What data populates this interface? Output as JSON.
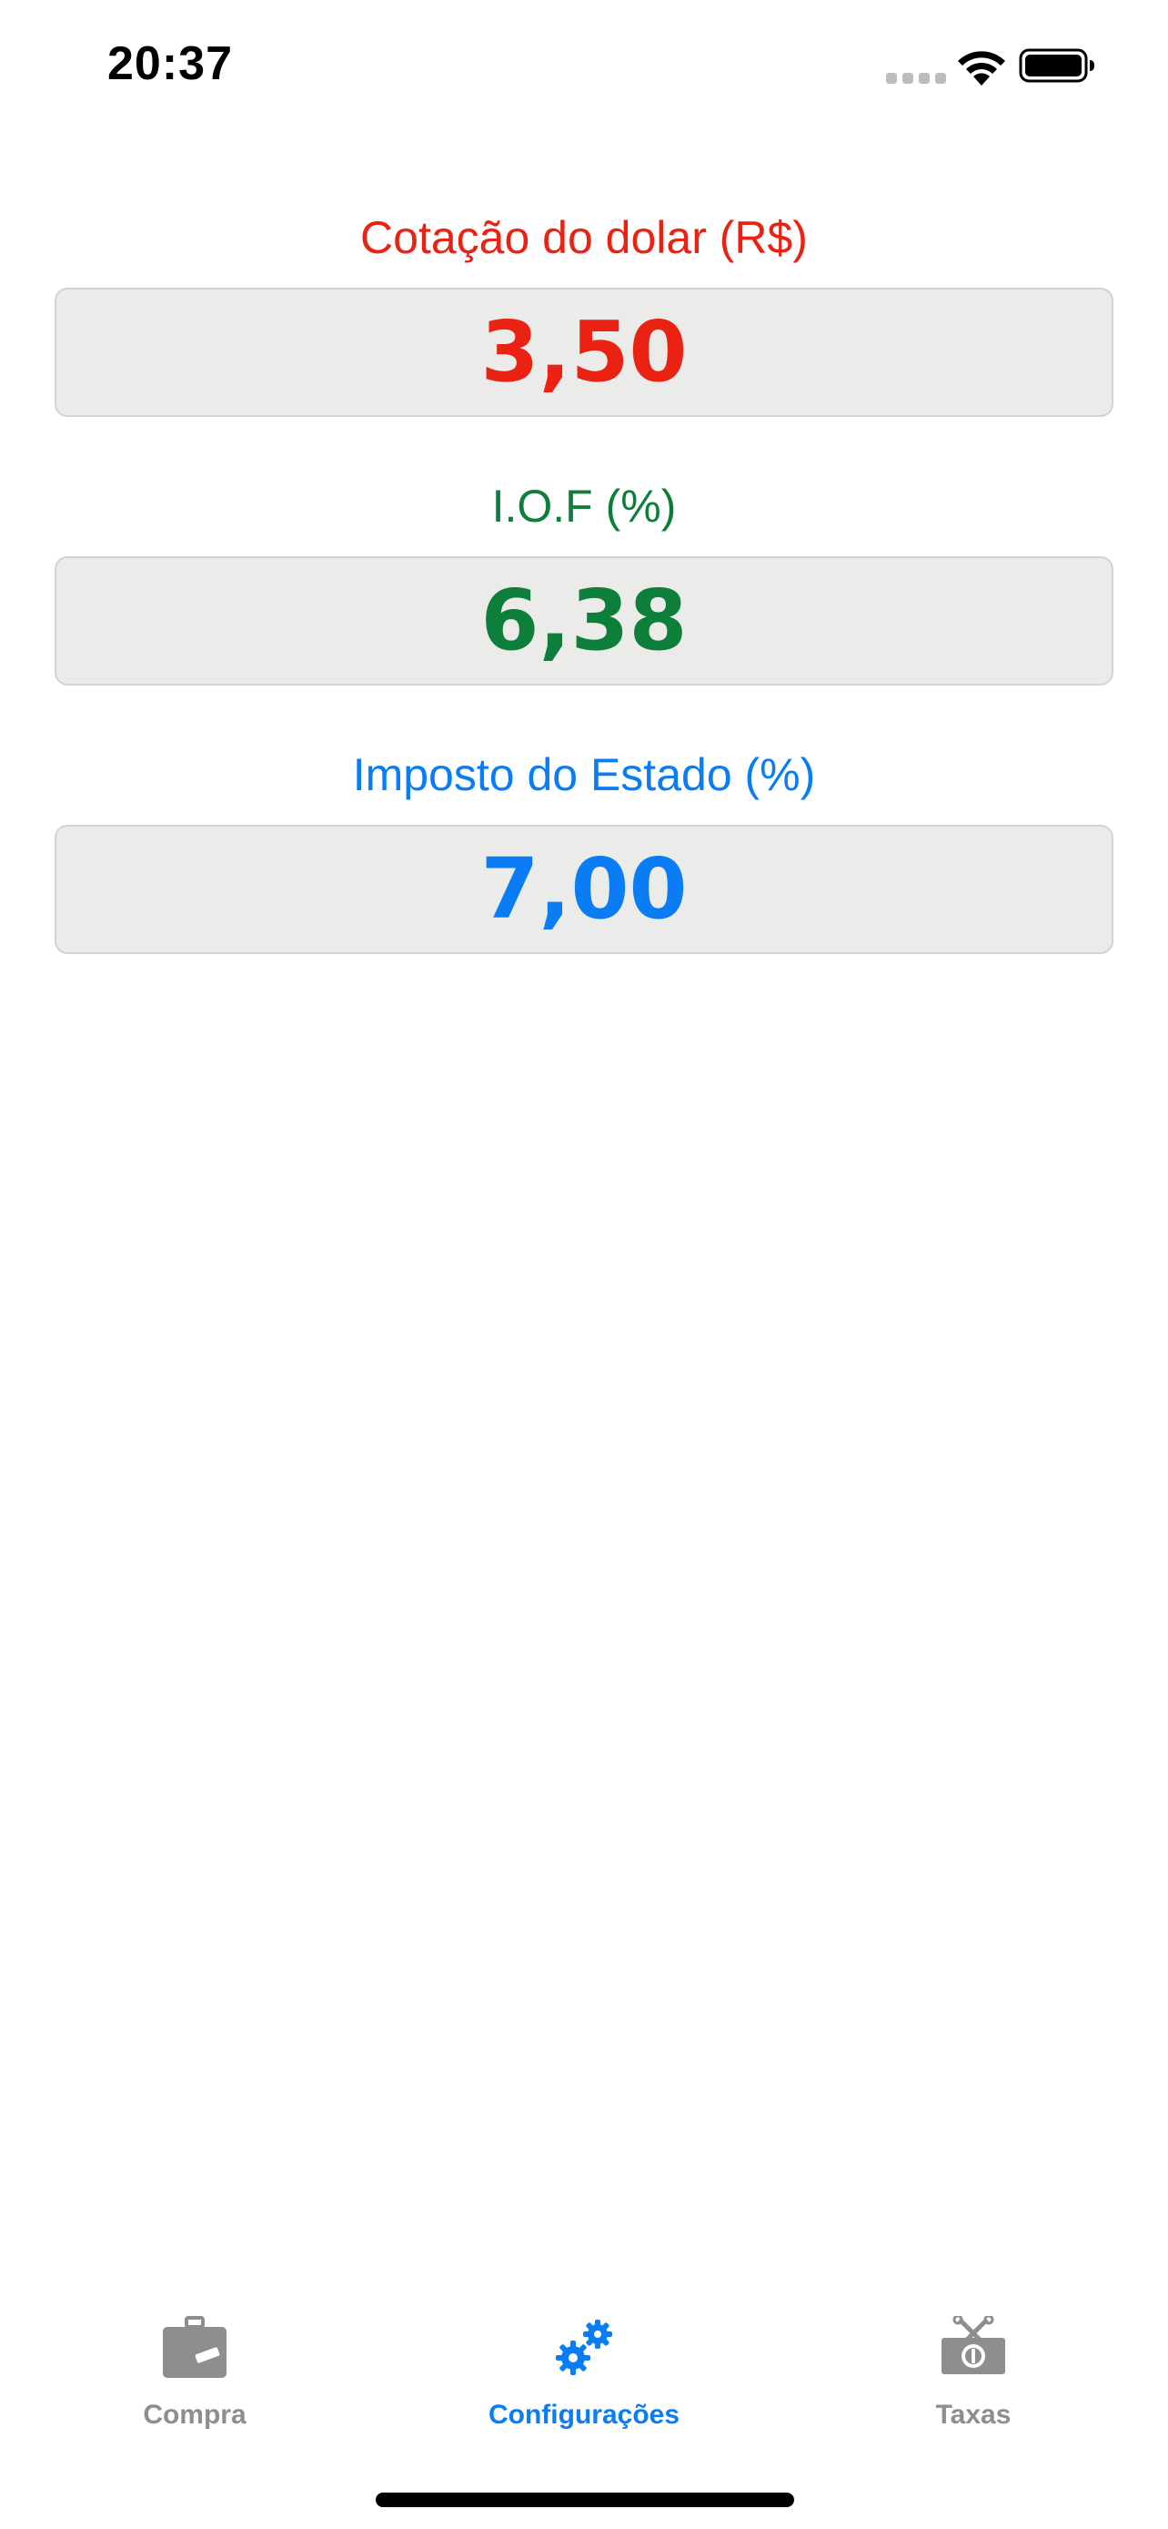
{
  "status_bar": {
    "time": "20:37"
  },
  "fields": {
    "dolar": {
      "label": "Cotação do dolar (R$)",
      "value": "3,50",
      "color": "#ea2213"
    },
    "iof": {
      "label": "I.O.F (%)",
      "value": "6,38",
      "color": "#0d7f3b"
    },
    "imposto": {
      "label": "Imposto do Estado (%)",
      "value": "7,00",
      "color": "#0a7df5"
    }
  },
  "tab_bar": {
    "tabs": [
      {
        "label": "Compra",
        "icon": "suitcase-icon",
        "active": false
      },
      {
        "label": "Configurações",
        "icon": "gears-icon",
        "active": true
      },
      {
        "label": "Taxas",
        "icon": "money-bill-icon",
        "active": false
      }
    ],
    "active_color": "#0a7df5",
    "inactive_color": "#8e8e8e"
  }
}
